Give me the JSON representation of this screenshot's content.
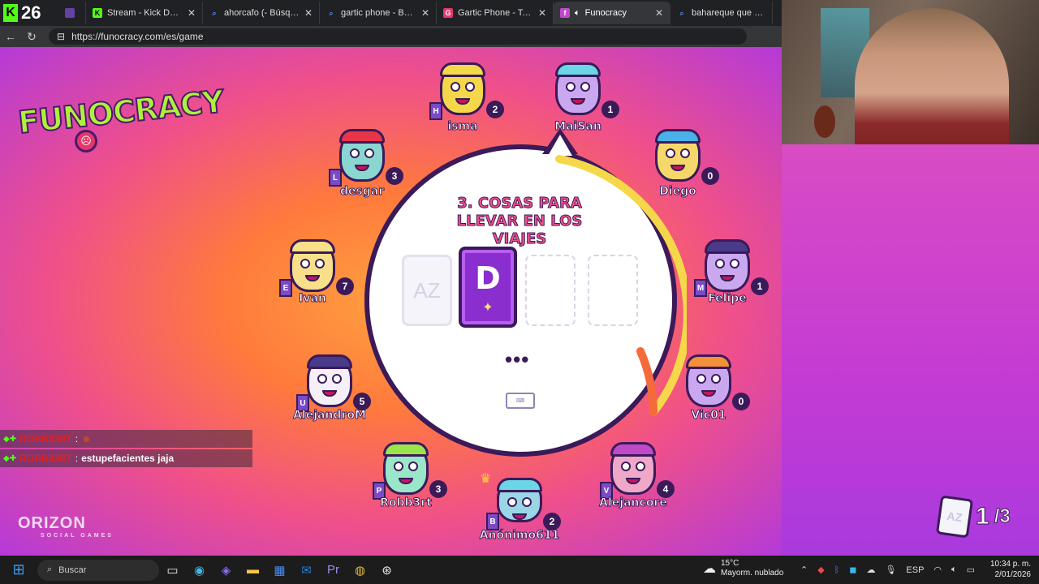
{
  "browser": {
    "kick_count": "26",
    "tabs": [
      {
        "title": "",
        "icon": "twitch-icon",
        "active": false
      },
      {
        "title": "Stream - Kick Dashboard",
        "icon": "kick-icon",
        "active": false
      },
      {
        "title": "ahorcafo (- Búsqueda",
        "icon": "search-icon",
        "active": false
      },
      {
        "title": "gartic phone - Búsqueda",
        "icon": "search-icon",
        "active": false
      },
      {
        "title": "Gartic Phone - Teléfono D",
        "icon": "gartic-icon",
        "active": false
      },
      {
        "title": "Funocracy",
        "icon": "funocracy-icon",
        "active": true
      },
      {
        "title": "bahareque que es - Búsq",
        "icon": "search-icon",
        "active": false
      }
    ],
    "url": "https://funocracy.com/es/game"
  },
  "game": {
    "logo_text": "FUNOCRACY",
    "question": "3. COSAS PARA LLEVAR EN LOS VIAJES",
    "current_letter": "D",
    "az_card_label": "AZ",
    "waiting_indicator": "•••",
    "round_current": "1",
    "round_total": "/3",
    "players": [
      {
        "name": "isma",
        "score": "2",
        "letter": "H",
        "color": "#f5d84a",
        "hair": "#f5d84a"
      },
      {
        "name": "MaiSan",
        "score": "1",
        "letter": "",
        "color": "#c9a8f0",
        "hair": "#6ad6e6"
      },
      {
        "name": "desgar",
        "score": "3",
        "letter": "L",
        "color": "#8ad6d0",
        "hair": "#e8354a"
      },
      {
        "name": "Diego",
        "score": "0",
        "letter": "",
        "color": "#f5d86a",
        "hair": "#4ab0e8"
      },
      {
        "name": "Ivan",
        "score": "7",
        "letter": "E",
        "color": "#f8e08a",
        "hair": "#f8e08a"
      },
      {
        "name": "Felipe",
        "score": "1",
        "letter": "M",
        "color": "#c9a8f0",
        "hair": "#4a3a8a"
      },
      {
        "name": "AlejandroM",
        "score": "5",
        "letter": "U",
        "color": "#f5f0f8",
        "hair": "#4a3a8a"
      },
      {
        "name": "Vic01",
        "score": "0",
        "letter": "",
        "color": "#c9a8f0",
        "hair": "#f5903a"
      },
      {
        "name": "Robb3rt",
        "score": "3",
        "letter": "P",
        "color": "#9ae6c8",
        "hair": "#9ae64a"
      },
      {
        "name": "Anónimo611",
        "score": "2",
        "letter": "B",
        "color": "#9ad6e6",
        "hair": "#6ad6e6"
      },
      {
        "name": "Alejancore",
        "score": "4",
        "letter": "V",
        "color": "#f0a8c8",
        "hair": "#c04ac8"
      }
    ]
  },
  "chat": [
    {
      "user": "ROBB33RT",
      "message": ""
    },
    {
      "user": "ROBB33RT",
      "message": "estupefacientes jaja"
    }
  ],
  "chat_separator": ":",
  "orizon": {
    "brand": "ORIZON",
    "tagline": "SOCIAL GAMES"
  },
  "taskbar": {
    "search_label": "Buscar",
    "weather_temp": "15°C",
    "weather_desc": "Mayorm. nublado",
    "language": "ESP",
    "time": "10:34 p. m.",
    "date": "2/01/2026"
  }
}
